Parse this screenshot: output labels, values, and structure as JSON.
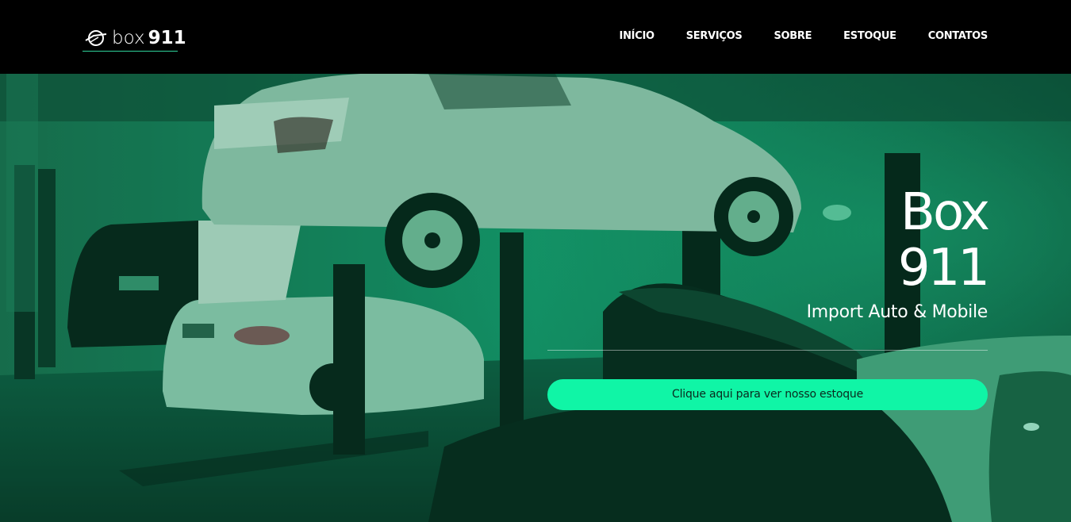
{
  "header": {
    "logo": {
      "prefix": "box",
      "number": "911"
    },
    "nav": [
      "INÍCIO",
      "SERVIÇOS",
      "SOBRE",
      "ESTOQUE",
      "CONTATOS"
    ]
  },
  "hero": {
    "title_line1": "Box",
    "title_line2": "911",
    "subtitle": "Import Auto & Mobile",
    "cta_label": "Clique aqui para ver nosso estoque",
    "background_description_icon": "garage-photo",
    "tint_color": "#12c98a",
    "cta_color": "#10f5a6"
  }
}
